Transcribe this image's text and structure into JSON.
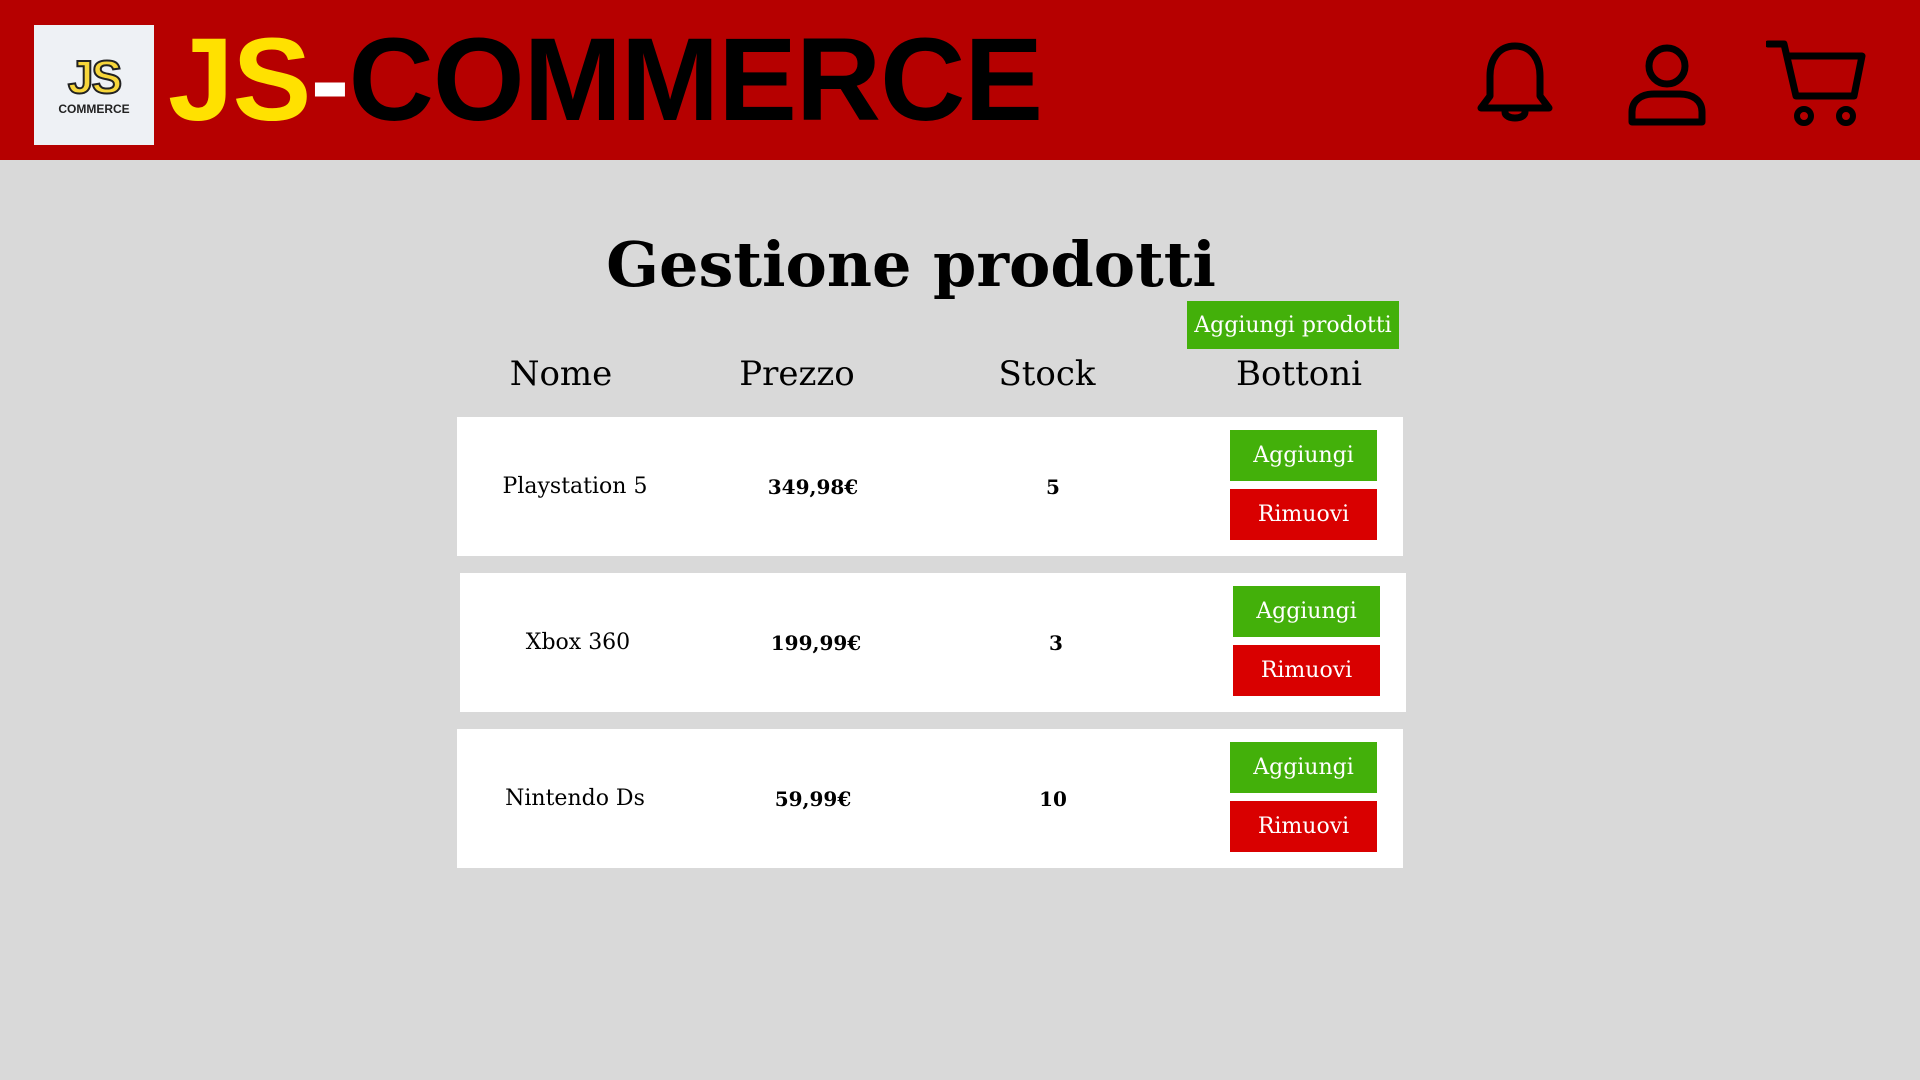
{
  "header": {
    "logo_mark": "JS",
    "logo_sub": "COMMERCE",
    "brand_js": "JS",
    "brand_dash": "-",
    "brand_rest": "COMMERCE",
    "icons": [
      "bell-icon",
      "user-icon",
      "cart-icon"
    ]
  },
  "page": {
    "title": "Gestione prodotti",
    "add_products_label": "Aggiungi prodotti"
  },
  "table": {
    "columns": [
      "Nome",
      "Prezzo",
      "Stock",
      "Bottoni"
    ],
    "rows": [
      {
        "name": "Playstation 5",
        "price": "349,98€",
        "stock": "5",
        "add_label": "Aggiungi",
        "remove_label": "Rimuovi"
      },
      {
        "name": "Xbox 360",
        "price": "199,99€",
        "stock": "3",
        "add_label": "Aggiungi",
        "remove_label": "Rimuovi"
      },
      {
        "name": "Nintendo Ds",
        "price": "59,99€",
        "stock": "10",
        "add_label": "Aggiungi",
        "remove_label": "Rimuovi"
      }
    ]
  },
  "colors": {
    "header_bg": "#b60000",
    "background": "#d9d9d9",
    "brand_yellow": "#ffe100",
    "add_green": "#43b00a",
    "remove_red": "#d90000"
  }
}
